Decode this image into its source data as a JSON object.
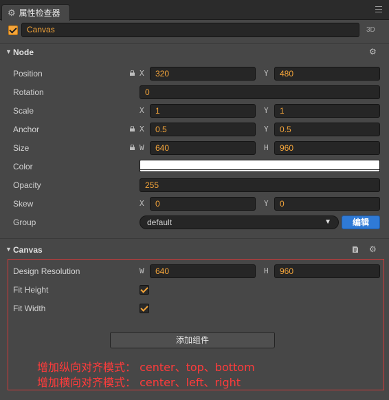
{
  "window": {
    "tab_title": "属性检查器"
  },
  "node": {
    "enabled": true,
    "name": "Canvas",
    "mode_badge": "3D"
  },
  "sections": {
    "node": {
      "title": "Node"
    },
    "canvas": {
      "title": "Canvas"
    }
  },
  "props": {
    "position": {
      "label": "Position",
      "x_axis": "X",
      "x": "320",
      "y_axis": "Y",
      "y": "480"
    },
    "rotation": {
      "label": "Rotation",
      "value": "0"
    },
    "scale": {
      "label": "Scale",
      "x_axis": "X",
      "x": "1",
      "y_axis": "Y",
      "y": "1"
    },
    "anchor": {
      "label": "Anchor",
      "x_axis": "X",
      "x": "0.5",
      "y_axis": "Y",
      "y": "0.5"
    },
    "size": {
      "label": "Size",
      "w_axis": "W",
      "w": "640",
      "h_axis": "H",
      "h": "960"
    },
    "color": {
      "label": "Color",
      "value": "#ffffff"
    },
    "opacity": {
      "label": "Opacity",
      "value": "255"
    },
    "skew": {
      "label": "Skew",
      "x_axis": "X",
      "x": "0",
      "y_axis": "Y",
      "y": "0"
    },
    "group": {
      "label": "Group",
      "value": "default",
      "edit_label": "编辑"
    }
  },
  "canvas": {
    "design_resolution": {
      "label": "Design Resolution",
      "w_axis": "W",
      "w": "640",
      "h_axis": "H",
      "h": "960"
    },
    "fit_height": {
      "label": "Fit Height",
      "checked": true
    },
    "fit_width": {
      "label": "Fit Width",
      "checked": true
    },
    "add_component_label": "添加组件"
  },
  "annotations": [
    "增加纵向对齐模式： center、top、bottom",
    "增加横向对齐模式： center、left、right"
  ],
  "colors": {
    "accent": "#f5a53a",
    "button_blue": "#2f7ad6",
    "annotation_red": "#ff3b3b"
  }
}
